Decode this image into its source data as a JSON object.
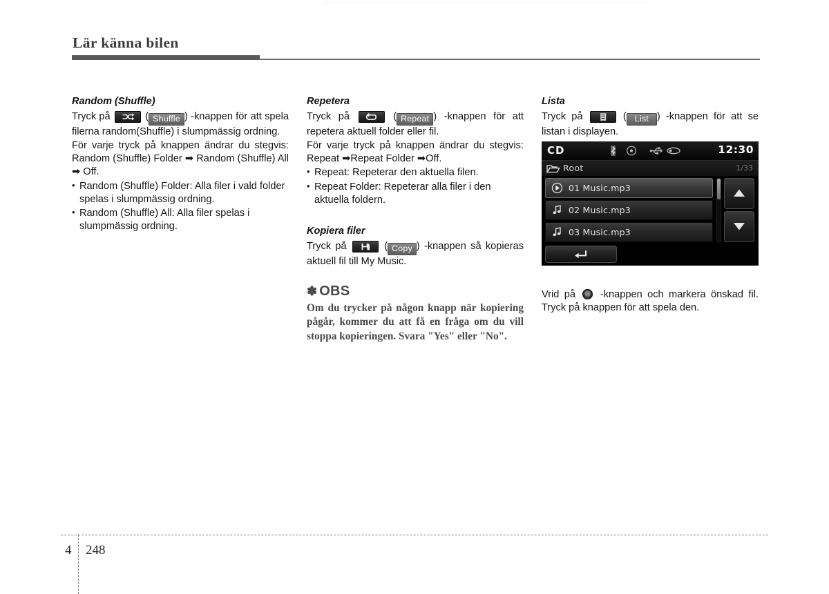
{
  "header": {
    "chapter_title": "Lär känna bilen"
  },
  "footer": {
    "chapter_number": "4",
    "page_number": "248"
  },
  "left_column": {
    "heading": "Random (Shuffle)",
    "para1_pre": "Tryck på",
    "hardkey_icon": "shuffle-icon",
    "softkey_label": "Shuffle",
    "para1_post": ") -knappen för att spela filerna random(Shuffle) i slumpmässig ordning.",
    "para2": "För varje tryck på knappen ändrar du stegvis: Random (Shuffle) Folder ➡ Random (Shuffle) All ➡ Off.",
    "bullets": [
      "Random (Shuffle) Folder: Alla filer i vald folder spelas i slumpmässig ordning.",
      "Random (Shuffle) All: Alla filer spelas i slumpmässig ordning."
    ]
  },
  "middle_column": {
    "heading": "Repetera",
    "para1_pre": "Tryck på",
    "hardkey_icon": "repeat-icon",
    "softkey_label": "Repeat",
    "para1_post": ") -knappen för att repetera aktuell folder eller fil.",
    "para2": "För varje tryck på knappen ändrar du stegvis: Repeat ➡Repeat Folder ➡Off.",
    "bullets": [
      "Repeat: Repeterar den aktuella filen.",
      "Repeat Folder: Repeterar alla filer i den aktuella foldern."
    ],
    "copy_heading": "Kopiera filer",
    "copy_para_pre": "Tryck på",
    "copy_hardkey_icon": "save-copy-icon",
    "copy_softkey_label": "Copy",
    "copy_para_post": ") -knappen så kopieras aktuell fil till My Music.",
    "note_star": "✽",
    "note_title": "OBS",
    "note_body": "Om du trycker på någon knapp när kopiering pågår, kommer du att få en fråga om du vill stoppa kopieringen. Svara \"Yes\" eller \"No\"."
  },
  "right_column": {
    "heading": "Lista",
    "para1_pre": "Tryck på",
    "hardkey_icon": "list-icon",
    "softkey_label": "List",
    "para1_post": ") -knappen för att se listan i displayen.",
    "knob_para_pre": "Vrid på",
    "knob_icon": "rotary-knob-icon",
    "knob_para_post": "-knappen och markera önskad fil. Tryck på knappen för att spela den."
  },
  "device_screen": {
    "status": {
      "source": "CD",
      "icons": [
        "bluetooth-icon",
        "disc-icon",
        "usb-icon",
        "aux-icon"
      ],
      "time": "12:30"
    },
    "path": {
      "folder_icon": "folder-icon",
      "label": "Root",
      "count": "1/33"
    },
    "files": [
      {
        "icon": "play-circle-icon",
        "label": "01 Music.mp3",
        "selected": true
      },
      {
        "icon": "music-note-icon",
        "label": "02 Music.mp3",
        "selected": false
      },
      {
        "icon": "music-note-icon",
        "label": "03 Music.mp3",
        "selected": false
      }
    ],
    "controls": {
      "scroll_up_icon": "triangle-up-icon",
      "scroll_down_icon": "triangle-down-icon",
      "back_icon": "back-arrow-icon"
    },
    "colors": {
      "background": "#000000",
      "selected_row": "#585858",
      "text": "#e6e6e6"
    }
  }
}
